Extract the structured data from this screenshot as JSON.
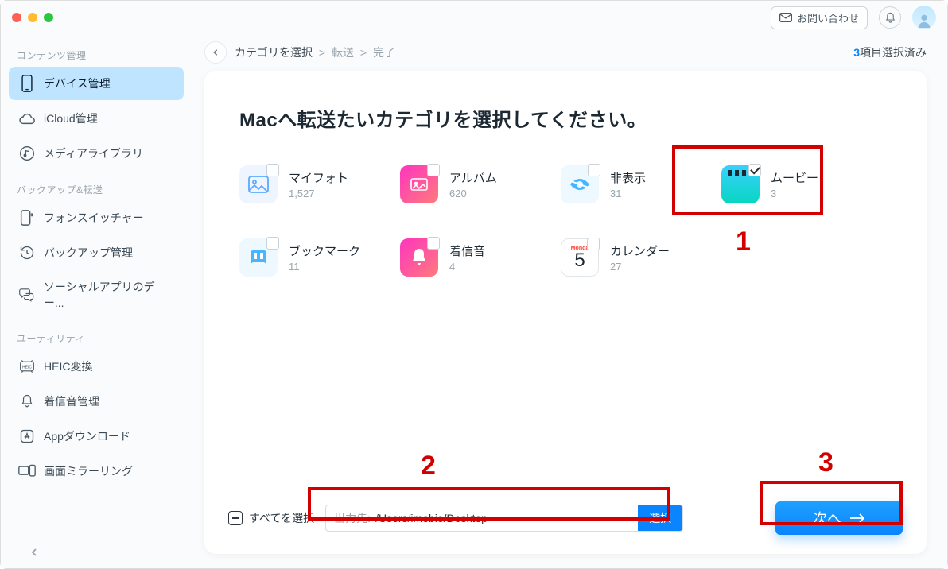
{
  "titlebar": {
    "contact_label": "お問い合わせ"
  },
  "sidebar": {
    "sections": {
      "content": "コンテンツ管理",
      "backup": "バックアップ&転送",
      "utility": "ユーティリティ"
    },
    "items": {
      "device": "デバイス管理",
      "icloud": "iCloud管理",
      "media": "メディアライブラリ",
      "phoneswitch": "フォンスイッチャー",
      "backupmgr": "バックアップ管理",
      "social": "ソーシャルアプリのデー...",
      "heic": "HEIC変換",
      "ringtone": "着信音管理",
      "appdl": "Appダウンロード",
      "mirror": "画面ミラーリング"
    }
  },
  "breadcrumb": {
    "step1": "カテゴリを選択",
    "step2": "転送",
    "step3": "完了"
  },
  "selected": {
    "count": "3",
    "suffix": "項目選択済み"
  },
  "heading": "Macへ転送たいカテゴリを選択してください。",
  "categories": {
    "photo": {
      "label": "マイフォト",
      "count": "1,527",
      "checked": false
    },
    "album": {
      "label": "アルバム",
      "count": "620",
      "checked": false
    },
    "hidden": {
      "label": "非表示",
      "count": "31",
      "checked": false
    },
    "movie": {
      "label": "ムービー",
      "count": "3",
      "checked": true
    },
    "bookmark": {
      "label": "ブックマーク",
      "count": "11",
      "checked": false
    },
    "ringtone": {
      "label": "着信音",
      "count": "4",
      "checked": false
    },
    "calendar": {
      "label": "カレンダー",
      "count": "27",
      "checked": false
    }
  },
  "bottom": {
    "select_all": "すべてを選択",
    "dest_label": "出力先:",
    "dest_path": "/Users/imobie/Desktop",
    "choose_label": "選択",
    "next_label": "次へ"
  },
  "annotations": {
    "n1": "1",
    "n2": "2",
    "n3": "3"
  },
  "calendar_icon": {
    "weekday": "Monda",
    "day": "5"
  }
}
